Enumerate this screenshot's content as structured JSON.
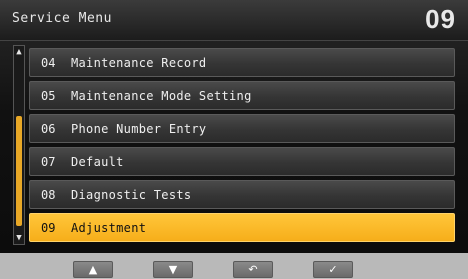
{
  "header": {
    "title": "Service Menu",
    "page_number": "09"
  },
  "menu": {
    "items": [
      {
        "num": "04",
        "label": "Maintenance Record",
        "selected": false
      },
      {
        "num": "05",
        "label": "Maintenance Mode Setting",
        "selected": false
      },
      {
        "num": "06",
        "label": "Phone Number Entry",
        "selected": false
      },
      {
        "num": "07",
        "label": "Default",
        "selected": false
      },
      {
        "num": "08",
        "label": "Diagnostic Tests",
        "selected": false
      },
      {
        "num": "09",
        "label": "Adjustment",
        "selected": true
      }
    ]
  },
  "scrollbar": {
    "up_icon": "▲",
    "down_icon": "▼"
  },
  "softkeys": {
    "up": "▲",
    "down": "▼",
    "back": "↶",
    "ok": "✓"
  },
  "colors": {
    "selected": "#f6ae1a",
    "scroll_thumb": "#e9a826"
  }
}
